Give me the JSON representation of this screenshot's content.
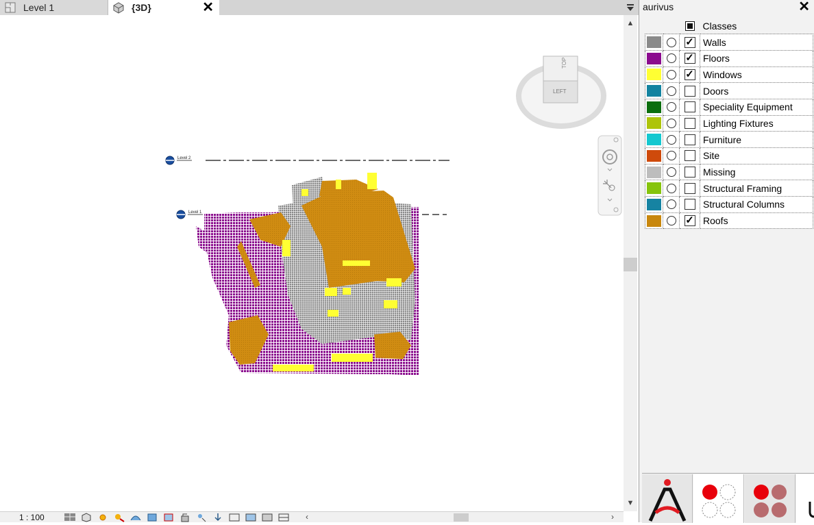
{
  "tabs": [
    {
      "label": "Level 1",
      "icon": "floor-plan-icon",
      "active": false
    },
    {
      "label": "{3D}",
      "icon": "3d-view-icon",
      "active": true
    }
  ],
  "viewport": {
    "level_markers": [
      {
        "label": "Level 2"
      },
      {
        "label": "Level 1"
      }
    ],
    "viewcube": {
      "top_label": "TOP",
      "face_label": "LEFT"
    }
  },
  "status": {
    "scale": "1 : 100"
  },
  "panel": {
    "title": "aurivus",
    "header_label": "Classes",
    "classes": [
      {
        "name": "Walls",
        "color": "#8a8a8a",
        "checked": true
      },
      {
        "name": "Floors",
        "color": "#8b0b8e",
        "checked": true
      },
      {
        "name": "Windows",
        "color": "#ffff33",
        "checked": true
      },
      {
        "name": "Doors",
        "color": "#1383a0",
        "checked": false
      },
      {
        "name": "Speciality Equipment",
        "color": "#0b6e0e",
        "checked": false
      },
      {
        "name": "Lighting Fixtures",
        "color": "#aec40a",
        "checked": false
      },
      {
        "name": "Furniture",
        "color": "#14c8d0",
        "checked": false
      },
      {
        "name": "Site",
        "color": "#cf4a0b",
        "checked": false
      },
      {
        "name": "Missing",
        "color": "#bdbdbd",
        "checked": false
      },
      {
        "name": "Structural Framing",
        "color": "#86c40d",
        "checked": false
      },
      {
        "name": "Structural Columns",
        "color": "#1683a2",
        "checked": false
      },
      {
        "name": "Roofs",
        "color": "#c8870d",
        "checked": true
      }
    ]
  }
}
